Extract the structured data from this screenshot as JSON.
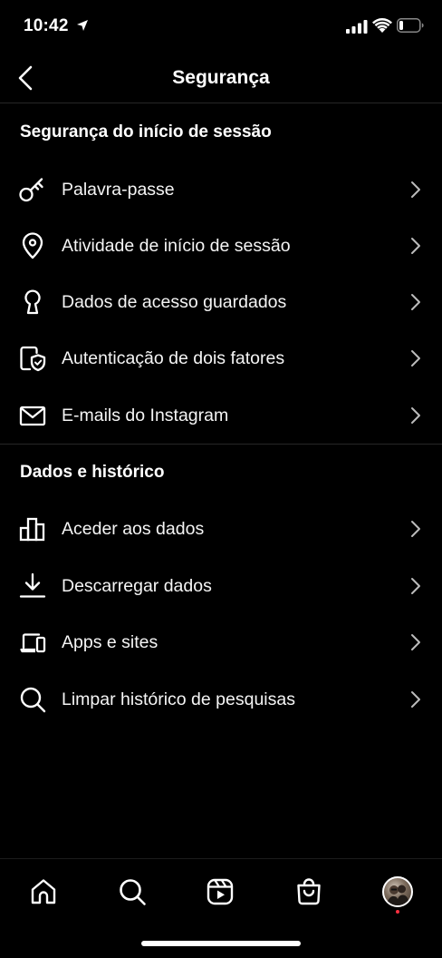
{
  "status_bar": {
    "time": "10:42"
  },
  "header": {
    "title": "Segurança"
  },
  "sections": [
    {
      "title": "Segurança do início de sessão",
      "items": [
        {
          "label": "Palavra-passe",
          "icon": "key-icon"
        },
        {
          "label": "Atividade de início de sessão",
          "icon": "location-pin-icon"
        },
        {
          "label": "Dados de acesso guardados",
          "icon": "keyhole-icon"
        },
        {
          "label": "Autenticação de dois fatores",
          "icon": "shield-phone-icon"
        },
        {
          "label": "E-mails do Instagram",
          "icon": "mail-icon"
        }
      ]
    },
    {
      "title": "Dados e histórico",
      "items": [
        {
          "label": "Aceder aos dados",
          "icon": "bar-chart-icon"
        },
        {
          "label": "Descarregar dados",
          "icon": "download-icon"
        },
        {
          "label": "Apps e sites",
          "icon": "devices-icon"
        },
        {
          "label": "Limpar histórico de pesquisas",
          "icon": "search-icon"
        }
      ]
    }
  ],
  "tab_bar": {
    "items": [
      "home-icon",
      "search-icon",
      "reels-icon",
      "shop-icon",
      "profile-avatar"
    ]
  },
  "colors": {
    "background": "#000000",
    "text": "#ffffff",
    "divider": "#262626",
    "notification_dot": "#ff3040"
  }
}
